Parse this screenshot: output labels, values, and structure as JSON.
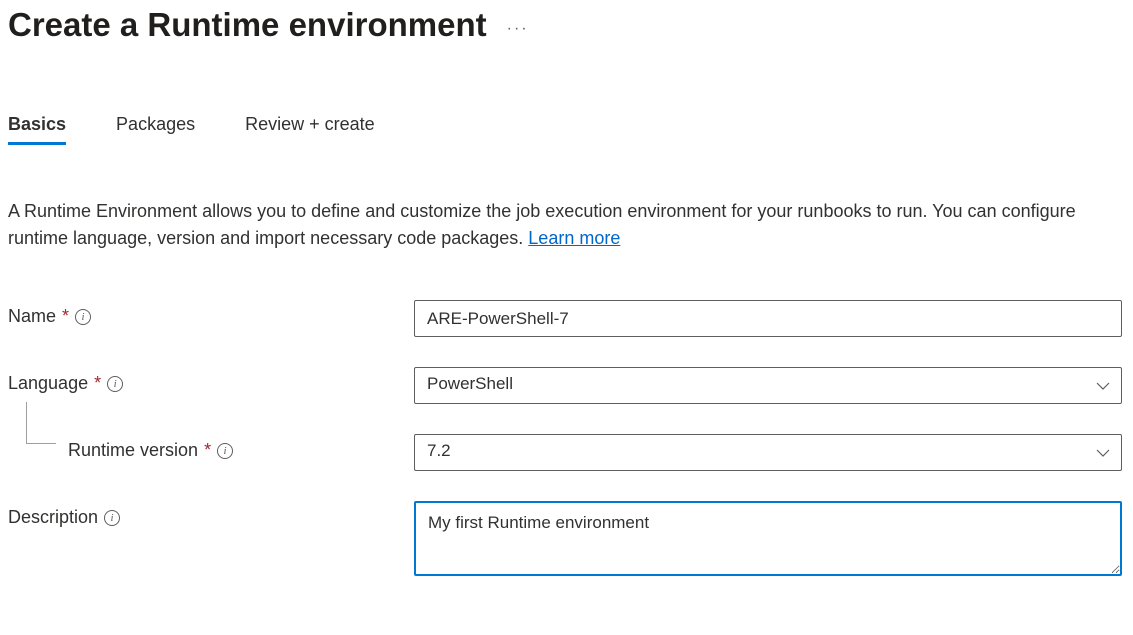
{
  "header": {
    "title": "Create a Runtime environment"
  },
  "tabs": {
    "basics": "Basics",
    "packages": "Packages",
    "review": "Review + create"
  },
  "intro": {
    "text": "A Runtime Environment allows you to define and customize the job execution environment for your runbooks to run. You can configure runtime language, version and import necessary code packages. ",
    "learnMore": "Learn more"
  },
  "form": {
    "name": {
      "label": "Name",
      "value": "ARE-PowerShell-7"
    },
    "language": {
      "label": "Language",
      "value": "PowerShell"
    },
    "runtimeVersion": {
      "label": "Runtime version",
      "value": "7.2"
    },
    "description": {
      "label": "Description",
      "value": "My first Runtime environment"
    }
  }
}
